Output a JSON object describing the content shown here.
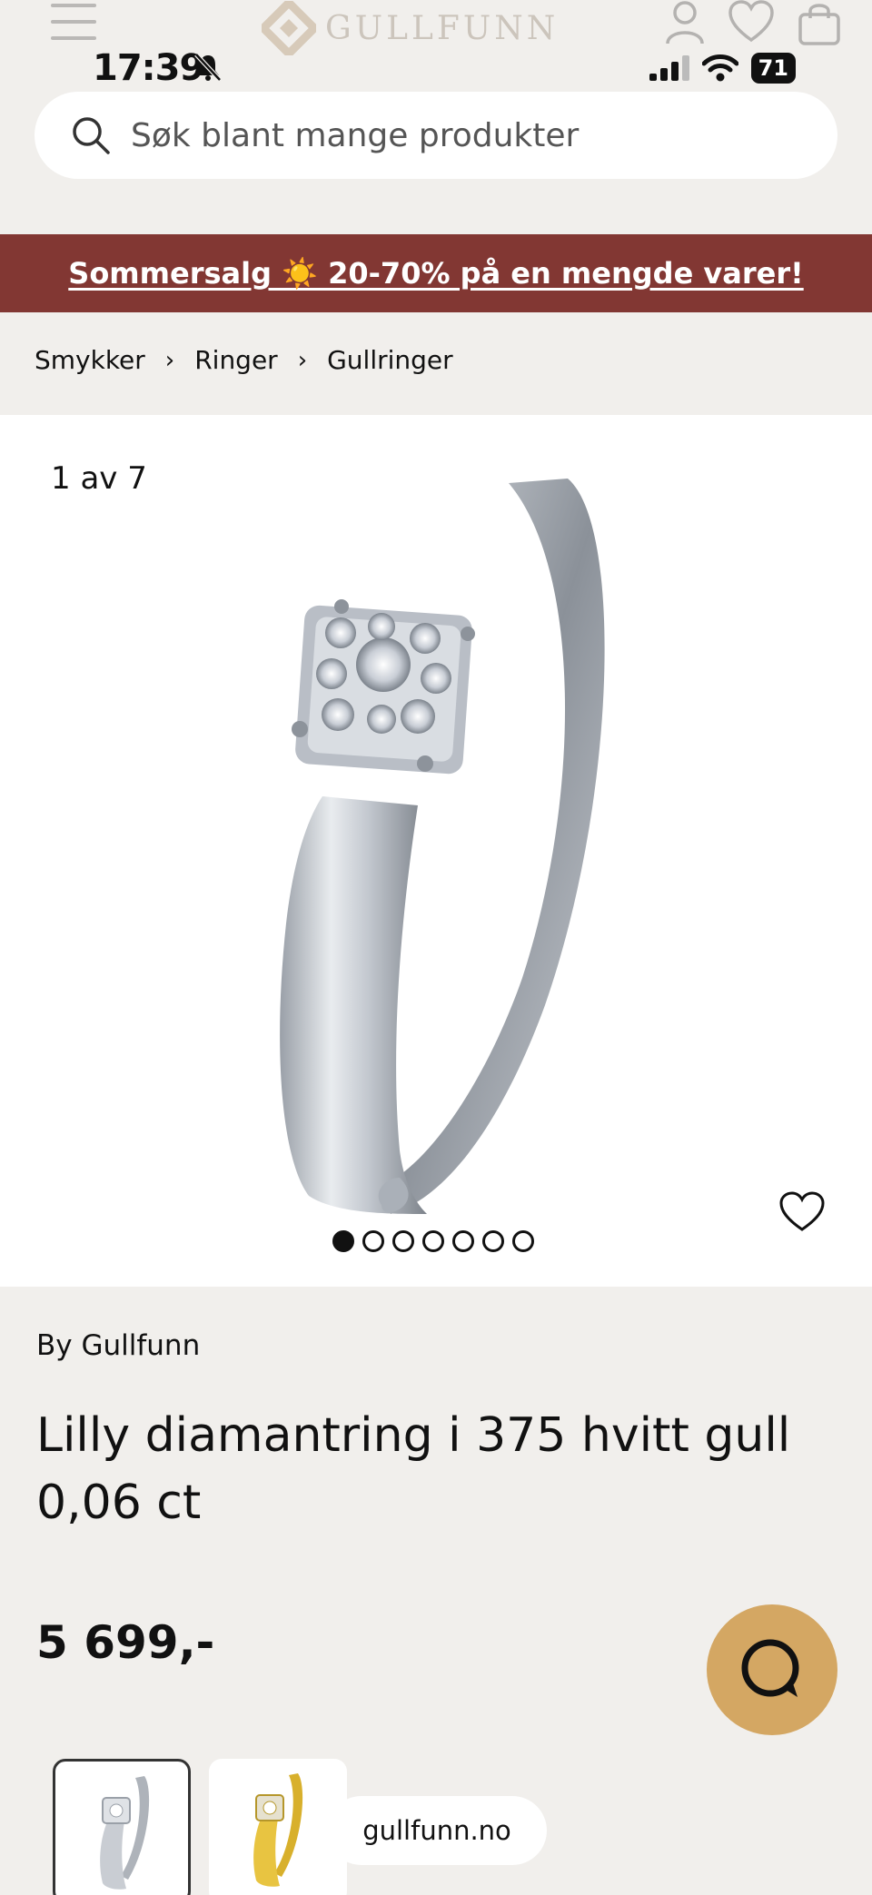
{
  "header": {
    "logo_text": "GULLFUNN",
    "brand_color": "#8a7a66"
  },
  "status_bar": {
    "time": "17:39",
    "battery": "71"
  },
  "search": {
    "placeholder": "Søk blant mange produkter"
  },
  "promo": {
    "text": "Sommersalg ☀️ 20-70% på en mengde varer!",
    "background": "#823733"
  },
  "breadcrumb": {
    "items": [
      "Smykker",
      "Ringer",
      "Gullringer"
    ]
  },
  "gallery": {
    "counter": "1 av 7",
    "total_images": 7,
    "active_index": 0
  },
  "product": {
    "brand": "By Gullfunn",
    "title": "Lilly diamantring i 375 hvitt gull 0,06 ct",
    "price": "5 699,-"
  },
  "chat": {
    "color": "#d4a763"
  },
  "site_pill": {
    "text": "gullfunn.no"
  }
}
